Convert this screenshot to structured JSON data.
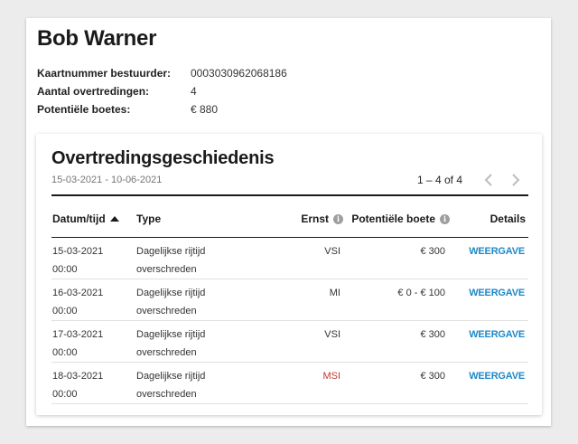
{
  "driver": {
    "name": "Bob Warner",
    "fields": [
      {
        "label": "Kaartnummer bestuurder:",
        "value": "0003030962068186"
      },
      {
        "label": "Aantal overtredingen:",
        "value": "4"
      },
      {
        "label": "Potentiële boetes:",
        "value": "€ 880"
      }
    ]
  },
  "history": {
    "title": "Overtredingsgeschiedenis",
    "date_range": "15-03-2021 - 10-06-2021",
    "pagination": "1 – 4 of 4",
    "columns": {
      "date": "Datum/tijd",
      "type": "Type",
      "severity": "Ernst",
      "fine": "Potentiële boete",
      "details": "Details"
    },
    "rows": [
      {
        "date": "15-03-2021",
        "time": "00:00",
        "type_line1": "Dagelijkse rijtijd",
        "type_line2": "overschreden",
        "severity": "VSI",
        "severity_color": "#333333",
        "fine": "€ 300",
        "details": "WEERGAVE"
      },
      {
        "date": "16-03-2021",
        "time": "00:00",
        "type_line1": "Dagelijkse rijtijd",
        "type_line2": "overschreden",
        "severity": "MI",
        "severity_color": "#333333",
        "fine": "€ 0 - € 100",
        "details": "WEERGAVE"
      },
      {
        "date": "17-03-2021",
        "time": "00:00",
        "type_line1": "Dagelijkse rijtijd",
        "type_line2": "overschreden",
        "severity": "VSI",
        "severity_color": "#333333",
        "fine": "€ 300",
        "details": "WEERGAVE"
      },
      {
        "date": "18-03-2021",
        "time": "00:00",
        "type_line1": "Dagelijkse rijtijd",
        "type_line2": "overschreden",
        "severity": "MSI",
        "severity_color": "#c0392b",
        "fine": "€ 300",
        "details": "WEERGAVE"
      }
    ]
  },
  "colors": {
    "link": "#1e88c8",
    "severity_high": "#c0392b"
  },
  "icons": {
    "sort": "sort-ascending-icon",
    "info": "info-icon",
    "prev": "chevron-left-icon",
    "next": "chevron-right-icon"
  }
}
